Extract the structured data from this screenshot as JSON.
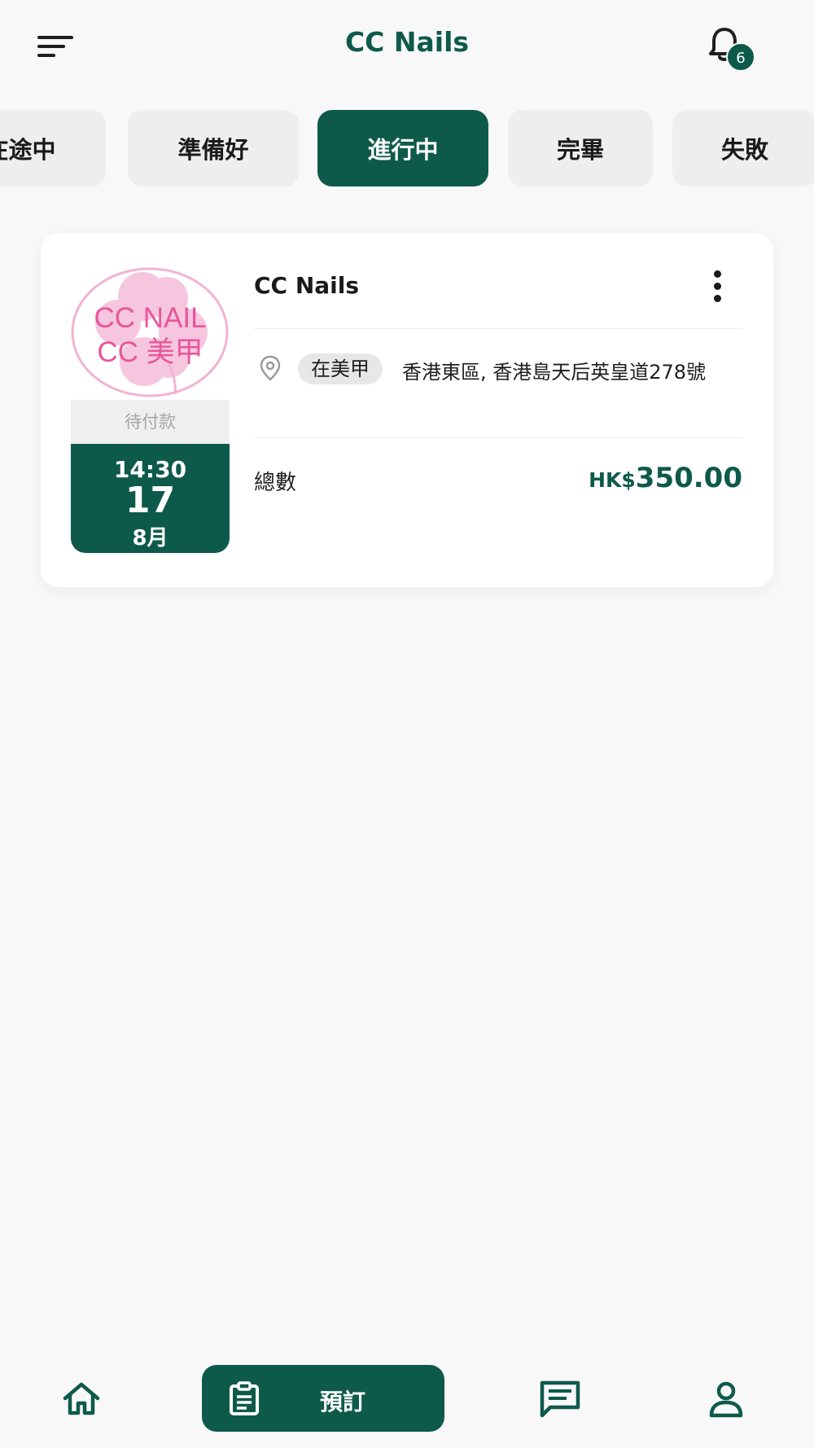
{
  "header": {
    "title": "CC Nails",
    "notification_count": "6"
  },
  "tabs": [
    {
      "label": "在途中",
      "active": false
    },
    {
      "label": "準備好",
      "active": false
    },
    {
      "label": "進行中",
      "active": true
    },
    {
      "label": "完畢",
      "active": false
    },
    {
      "label": "失敗",
      "active": false
    }
  ],
  "booking": {
    "logo_text_line1": "CC NAIL",
    "logo_text_line2": "CC 美甲",
    "payment_status": "待付款",
    "time": "14:30",
    "day": "17",
    "month": "8月",
    "shop_name": "CC Nails",
    "location_tag": "在美甲",
    "address": "香港東區, 香港島天后英皇道278號",
    "total_label": "總數",
    "currency": "HK$",
    "amount": "350.00"
  },
  "bottom_nav": {
    "book_label": "預訂"
  },
  "colors": {
    "brand": "#0e5a4a",
    "logo_pink": "#e8569a"
  }
}
